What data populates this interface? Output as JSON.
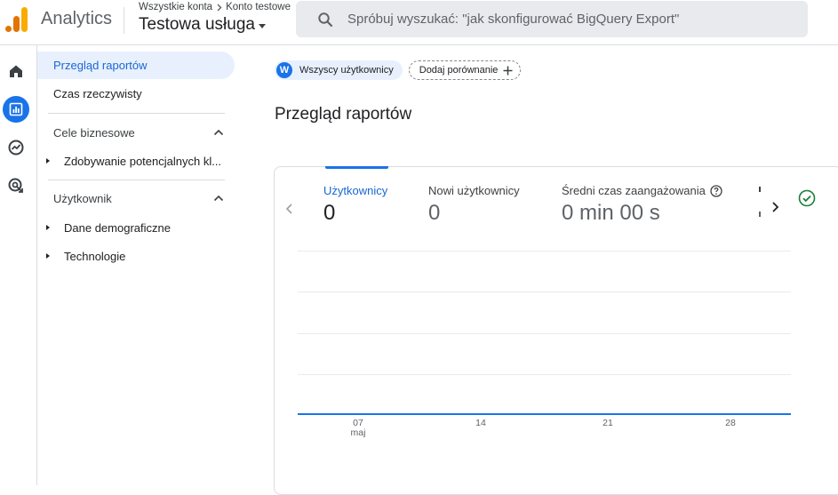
{
  "header": {
    "app_name": "Analytics",
    "breadcrumb": [
      "Wszystkie konta",
      "Konto testowe"
    ],
    "property_name": "Testowa usługa",
    "search_placeholder": "Spróbuj wyszukać: \"jak skonfigurować BigQuery Export\""
  },
  "rail": {
    "items": [
      {
        "icon": "home-icon",
        "active": false
      },
      {
        "icon": "reports-icon",
        "active": true
      },
      {
        "icon": "explore-icon",
        "active": false
      },
      {
        "icon": "advertising-icon",
        "active": false
      }
    ]
  },
  "sidenav": {
    "items": [
      {
        "label": "Przegląd raportów",
        "active": true
      },
      {
        "label": "Czas rzeczywisty",
        "active": false
      }
    ],
    "sections": [
      {
        "label": "Cele biznesowe",
        "expanded": true,
        "children": [
          "Zdobywanie potencjalnych kl..."
        ]
      },
      {
        "label": "Użytkownik",
        "expanded": true,
        "children": [
          "Dane demograficzne",
          "Technologie"
        ]
      }
    ]
  },
  "main": {
    "segment_chip": {
      "avatar": "W",
      "label": "Wszyscy użytkownicy"
    },
    "compare_chip": {
      "label": "Dodaj porównanie"
    },
    "title": "Przegląd raportów"
  },
  "card": {
    "metrics": [
      {
        "label": "Użytkownicy",
        "value": "0",
        "active": true
      },
      {
        "label": "Nowi użytkownicy",
        "value": "0",
        "active": false
      },
      {
        "label": "Średni czas zaangażowania",
        "value": "0 min 00 s",
        "active": false,
        "help": true
      }
    ],
    "status_icon": "check-circle-icon"
  },
  "chart_data": {
    "type": "line",
    "x": [
      "07 maj",
      "14",
      "21",
      "28"
    ],
    "series": [
      {
        "values": [
          0,
          0,
          0,
          0
        ]
      }
    ],
    "ylim": [
      0,
      1
    ],
    "grid": true,
    "xlabel": "",
    "ylabel": ""
  },
  "colors": {
    "accent": "#1a73e8",
    "active_bg": "#e8f0fe",
    "success": "#188038",
    "logo_orange": "#f9ab00",
    "logo_dark_orange": "#e37400"
  }
}
